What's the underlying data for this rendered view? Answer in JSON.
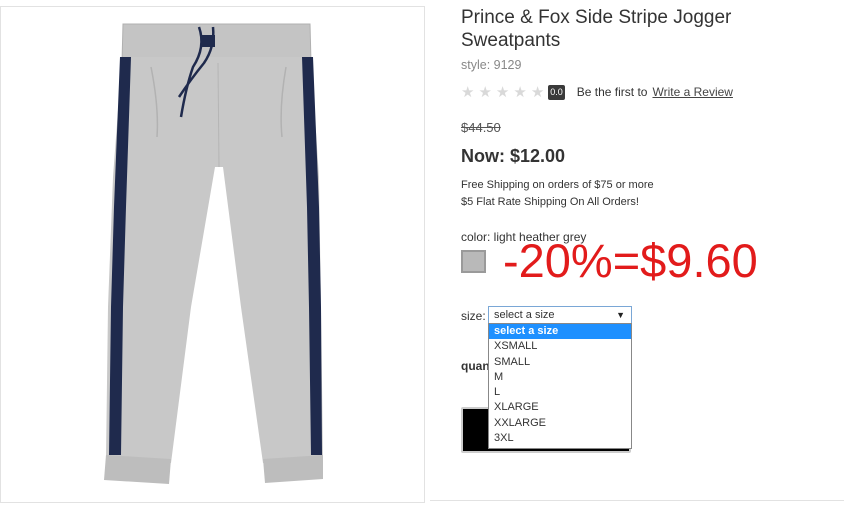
{
  "product": {
    "title": "Prince & Fox Side Stripe Jogger Sweatpants",
    "style": "style: 9129"
  },
  "rating": {
    "stars": [
      "★",
      "★",
      "★",
      "★",
      "★"
    ],
    "score": "0.0",
    "prompt": "Be the first to",
    "review_link": "Write a Review"
  },
  "price": {
    "original": "$44.50",
    "now": "Now: $12.00"
  },
  "shipping": {
    "line1": "Free Shipping on orders of $75 or more",
    "line2": "$5 Flat Rate Shipping On All Orders!"
  },
  "color": {
    "label": "color: light heather grey",
    "swatch_color": "#b9b9b9"
  },
  "annotation": {
    "text": "-20%=$9.60",
    "color": "#e21b1b"
  },
  "size": {
    "label": "size:",
    "selected": "select a size",
    "options": [
      "select a size",
      "XSMALL",
      "SMALL",
      "M",
      "L",
      "XLARGE",
      "XXLARGE",
      "3XL"
    ]
  },
  "quantity": {
    "label": "quan"
  }
}
